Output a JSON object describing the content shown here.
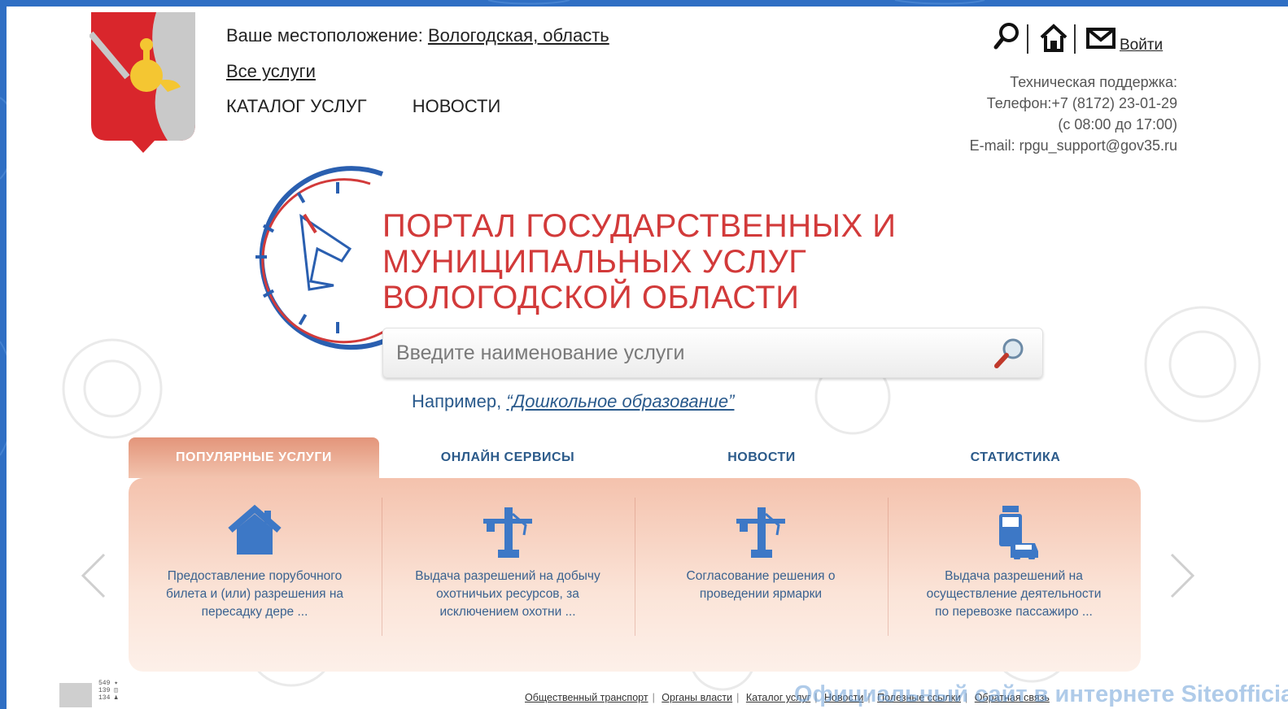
{
  "header": {
    "location_prefix": "Ваше местоположение:",
    "location_value": "Вологодская, область",
    "all_services": "Все услуги",
    "nav": [
      "КАТАЛОГ УСЛУГ",
      "НОВОСТИ"
    ],
    "login": "Войти"
  },
  "support": {
    "line1": "Техническая поддержка:",
    "line2": "Телефон:+7 (8172) 23-01-29",
    "line3": "(с 08:00 до 17:00)",
    "line4": "E-mail: rpgu_support@gov35.ru"
  },
  "portal": {
    "title_lines": [
      "ПОРТАЛ ГОСУДАРСТВЕННЫХ И",
      "МУНИЦИПАЛЬНЫХ УСЛУГ",
      "ВОЛОГОДСКОЙ ОБЛАСТИ"
    ],
    "brand_color": "#d23a3a"
  },
  "search": {
    "placeholder": "Введите наименование услуги",
    "example_prefix": "Например,",
    "example_value": "“Дошкольное образование”"
  },
  "tabs": [
    {
      "label": "ПОПУЛЯРНЫЕ УСЛУГИ",
      "active": true
    },
    {
      "label": "ОНЛАЙН СЕРВИСЫ",
      "active": false
    },
    {
      "label": "НОВОСТИ",
      "active": false
    },
    {
      "label": "СТАТИСТИКА",
      "active": false
    }
  ],
  "cards": [
    {
      "icon": "house-icon",
      "lines": [
        "Предоставление порубочного",
        "билета и (или) разрешения на",
        "пересадку дере ..."
      ]
    },
    {
      "icon": "crane-icon",
      "lines": [
        "Выдача разрешений на добычу",
        "охотничьих ресурсов, за",
        "исключением охотни ..."
      ]
    },
    {
      "icon": "crane-icon",
      "lines": [
        "Согласование решения о",
        "проведении ярмарки"
      ]
    },
    {
      "icon": "bus-car-icon",
      "lines": [
        "Выдача разрешений на",
        "осуществление деятельности",
        "по перевозке пассажиро ..."
      ]
    }
  ],
  "counter": {
    "line1": "549 ✦",
    "line2": "139 ◫",
    "line3": "134 ♟"
  },
  "footer": {
    "links": [
      "Общественный транспорт",
      "Органы власти",
      "Каталог услуг",
      "Новости",
      "Полезные ссылки",
      "Обратная связь"
    ]
  },
  "watermark": "Официальный сайт в интернете Siteofficial.ru"
}
